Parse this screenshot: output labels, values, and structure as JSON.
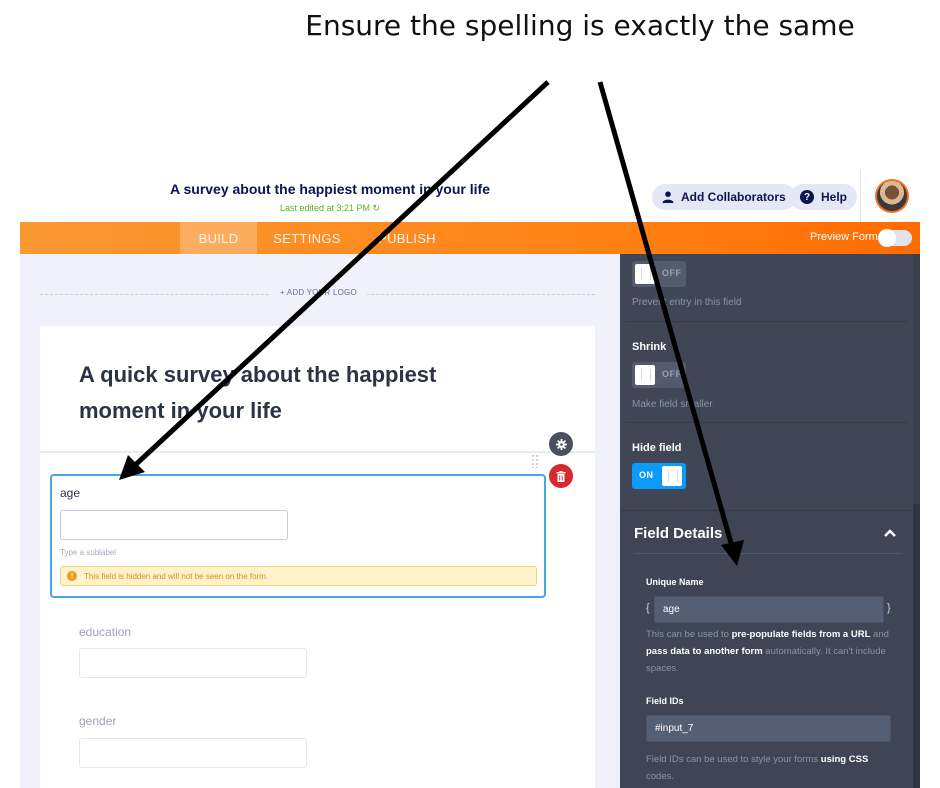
{
  "annotation": {
    "text": "Ensure the spelling is exactly the same"
  },
  "header": {
    "form_title": "A survey about the happiest moment in your life",
    "last_edited": "Last edited at 3:21 PM ↻",
    "add_collaborators_label": "Add Collaborators",
    "help_label": "Help",
    "help_icon_glyph": "?"
  },
  "nav": {
    "tabs": [
      {
        "label": "BUILD",
        "active": true
      },
      {
        "label": "SETTINGS",
        "active": false
      },
      {
        "label": "PUBLISH",
        "active": false
      }
    ],
    "preview_label": "Preview Form",
    "preview_on": false
  },
  "canvas": {
    "add_logo_label": "+ ADD YOUR LOGO",
    "form_heading": "A quick survey about the happiest moment in your life",
    "fields": [
      {
        "label": "age",
        "value": "",
        "sublabel_placeholder": "Type a sublabel",
        "warning": "This field is hidden and will not be seen on the form.",
        "warning_icon_glyph": "!",
        "selected": true
      },
      {
        "label": "education",
        "value": ""
      },
      {
        "label": "gender",
        "value": ""
      }
    ],
    "gear_glyph": "⚙",
    "trash_glyph": "🗑"
  },
  "panel": {
    "readonly_toggle": {
      "state": "OFF",
      "description": "Prevent entry in this field"
    },
    "shrink": {
      "title": "Shrink",
      "state": "OFF",
      "description": "Make field smaller"
    },
    "hide_field": {
      "title": "Hide field",
      "state": "ON"
    },
    "field_details": {
      "title": "Field Details",
      "chevron_glyph": "⌃",
      "unique_name": {
        "title": "Unique Name",
        "open_brace": "{",
        "close_brace": "}",
        "value": "age",
        "help_parts": [
          {
            "text": "This can be used to ",
            "bold": false
          },
          {
            "text": "pre-populate fields from a URL",
            "bold": true
          },
          {
            "text": " and ",
            "bold": false
          },
          {
            "text": "pass data to another form",
            "bold": true
          },
          {
            "text": " automatically. It can't include spaces.",
            "bold": false
          }
        ]
      },
      "field_ids": {
        "title": "Field IDs",
        "value": "#input_7",
        "help_parts": [
          {
            "text": "Field IDs can be used to style your forms ",
            "bold": false
          },
          {
            "text": "using CSS",
            "bold": true
          },
          {
            "text": " codes.",
            "bold": false
          }
        ]
      }
    }
  },
  "colors": {
    "brand_orange": "#ff8419",
    "navy": "#0a1551",
    "selected_border": "#4aa6e0",
    "toggle_on": "#0b9bfa",
    "panel_bg": "#404656",
    "warning_bg": "#fff3cc",
    "delete_red": "#d7282f"
  }
}
